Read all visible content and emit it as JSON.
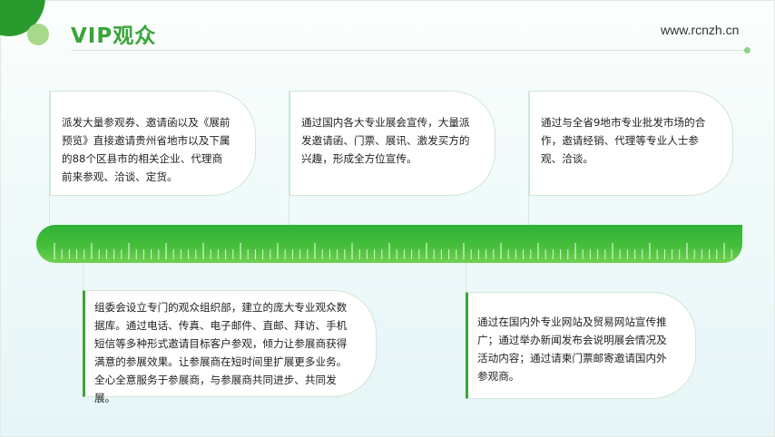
{
  "header": {
    "title": "VIP观众",
    "site": "www.rcnzh.cn"
  },
  "cards": [
    {
      "text": "派发大量参观券、邀请函以及《展前预览》直接邀请贵州省地市以及下属的88个区县市的相关企业、代理商前来参观、洽谈、定货。"
    },
    {
      "text": "通过国内各大专业展会宣传，大量派发邀请函、门票、展讯、激发买方的兴趣，形成全方位宣传。"
    },
    {
      "text": "通过与全省9地市专业批发市场的合作，邀请经销、代理等专业人士参观、洽谈。"
    },
    {
      "text": "组委会设立专门的观众组织部，建立的庞大专业观众数据库。通过电话、传真、电子邮件、直邮、拜访、手机短信等多种形式邀请目标客户参观，倾力让参展商获得满意的参展效果。让参展商在短时间里扩展更多业务。全心全意服务于参展商，与参展商共同进步、共同发展。"
    },
    {
      "text": "通过在国内外专业网站及贸易网站宣传推广；通过举办新闻发布会说明展会情况及活动内容；通过请柬门票邮寄邀请国内外参观商。"
    }
  ],
  "colors": {
    "accent": "#3aa53a",
    "accent_light": "#a7d98a",
    "accent_dark": "#2a9a2e",
    "ruler_top": "#2fb236",
    "ruler_bottom": "#6fd04e"
  }
}
